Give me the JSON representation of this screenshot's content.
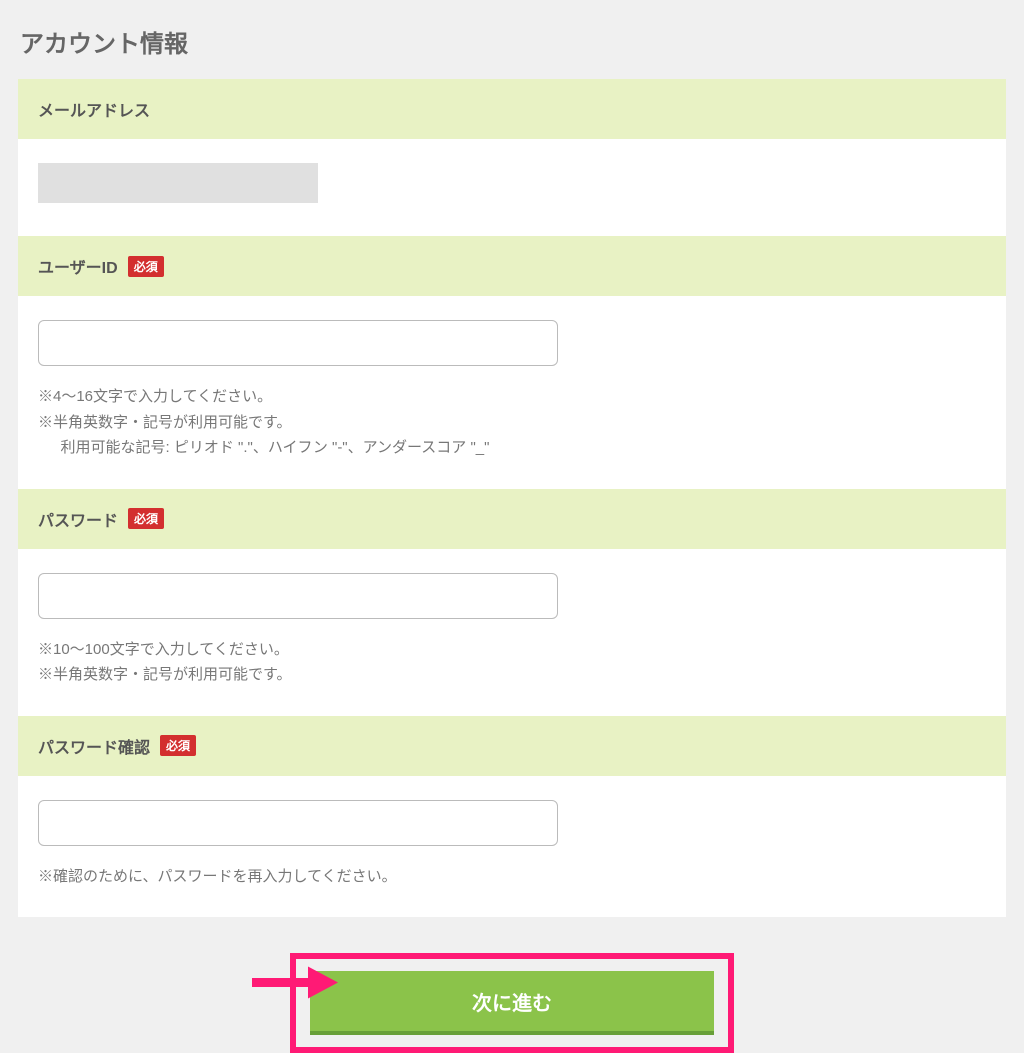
{
  "page": {
    "title": "アカウント情報"
  },
  "sections": {
    "email": {
      "label": "メールアドレス",
      "value": ""
    },
    "user_id": {
      "label": "ユーザーID",
      "required_badge": "必須",
      "value": "",
      "help": {
        "line1": "※4〜16文字で入力してください。",
        "line2": "※半角英数字・記号が利用可能です。",
        "line3": "利用可能な記号: ピリオド \".\"、ハイフン \"-\"、アンダースコア \"_\""
      }
    },
    "password": {
      "label": "パスワード",
      "required_badge": "必須",
      "value": "",
      "help": {
        "line1": "※10〜100文字で入力してください。",
        "line2": "※半角英数字・記号が利用可能です。"
      }
    },
    "password_confirm": {
      "label": "パスワード確認",
      "required_badge": "必須",
      "value": "",
      "help": {
        "line1": "※確認のために、パスワードを再入力してください。"
      }
    }
  },
  "submit": {
    "label": "次に進む"
  }
}
